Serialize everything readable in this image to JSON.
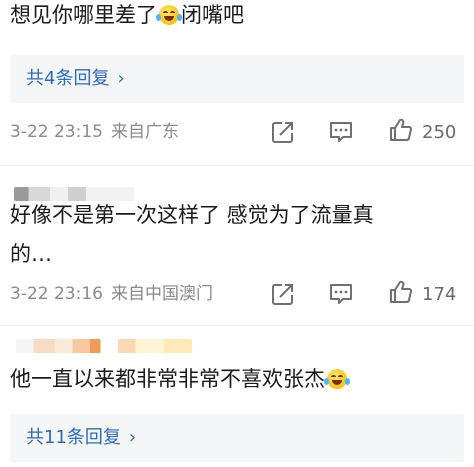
{
  "comments": [
    {
      "text_before": "想见你哪里差了",
      "emoji": "laugh-crying-emoji",
      "text_after": "闭嘴吧",
      "reply_link": "共4条回复",
      "date": "3-22 23:15",
      "location": "来自广东",
      "likes": "250"
    },
    {
      "line1": "好像不是第一次这样了 感觉为了流量真",
      "line2": "的…",
      "date": "3-22 23:16",
      "location": "来自中国澳门",
      "likes": "174"
    },
    {
      "text_before": "他一直以来都非常非常不喜欢张杰",
      "emoji": "crying-laughing-emoji",
      "reply_link": "共11条回复"
    }
  ],
  "reply_chevron": "›",
  "icons": [
    "share-icon",
    "comment-icon",
    "thumbs-up-icon"
  ],
  "colors": {
    "link": "#2f6bb5",
    "reply_box_bg": "#f4f5f7",
    "meta_text": "#8a8a8a",
    "text": "#1a1a1a"
  }
}
